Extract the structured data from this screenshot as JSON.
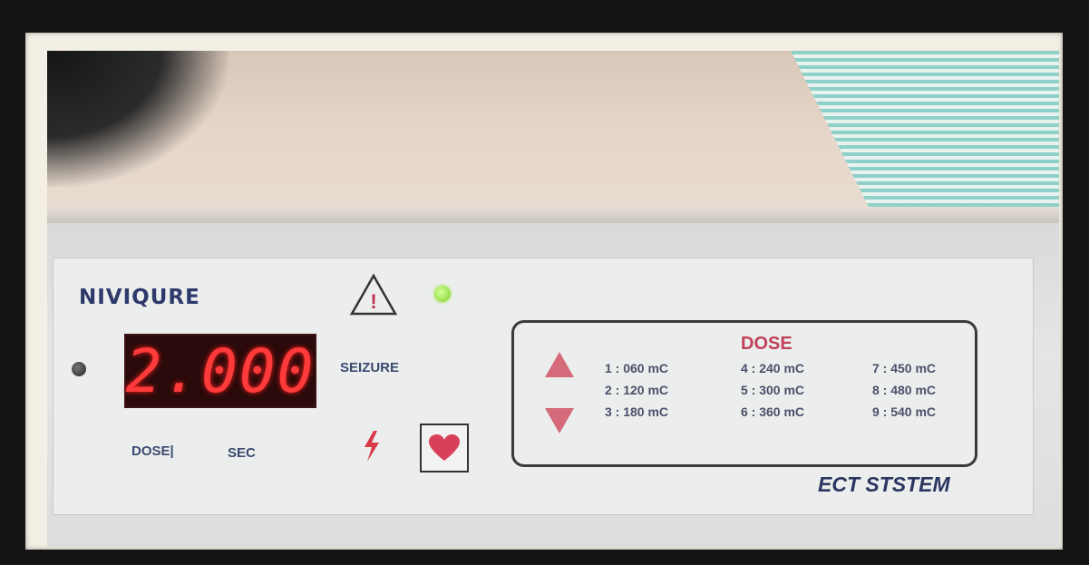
{
  "device": {
    "brand": "NIVIQURE",
    "display_value": "2.000",
    "label_dose": "DOSE|",
    "label_sec": "SEC",
    "label_seizure": "SEIZURE",
    "footer": "ECT STSTEM",
    "status_light_color": "#9fe34a",
    "display_color": "#ff3a3a"
  },
  "dose_panel": {
    "title": "DOSE",
    "options": [
      "1 : 060 mC",
      "4 : 240 mC",
      "7 : 450 mC",
      "2 : 120 mC",
      "5 : 300 mC",
      "8 : 480 mC",
      "3 : 180 mC",
      "6 : 360 mC",
      "9 : 540 mC"
    ]
  },
  "icons": {
    "warning": "warning-triangle-icon",
    "stimulus": "lightning-bolt-icon",
    "heart": "heart-icon",
    "up": "arrow-up-icon",
    "down": "arrow-down-icon"
  }
}
